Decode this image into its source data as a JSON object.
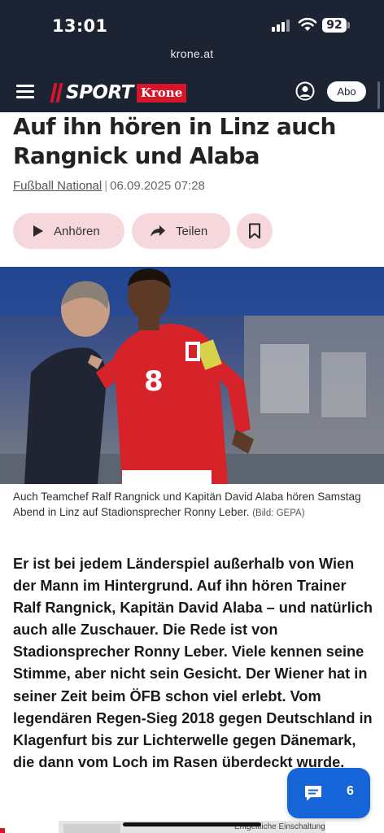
{
  "status_bar": {
    "time": "13:01",
    "battery": "92"
  },
  "browser": {
    "url": "krone.at"
  },
  "header": {
    "logo_text": "SPORT",
    "logo_brand": "Krone",
    "abo_label": "Abo"
  },
  "article": {
    "headline": "Auf ihn hören in Linz auch Rangnick und Alaba",
    "category": "Fußball National",
    "separator": "|",
    "date": "06.09.2025 07:28",
    "actions": {
      "listen_label": "Anhören",
      "share_label": "Teilen"
    },
    "caption": "Auch Teamchef Ralf Rangnick und Kapitän David Alaba hören Samstag Abend in Linz auf Stadionsprecher Ronny Leber.",
    "caption_credit": "(Bild: GEPA)",
    "lead": "Er ist bei jedem Länderspiel außerhalb von Wien der Mann im Hintergrund. Auf ihn hören Trainer Ralf Rangnick, Kapitän David Alaba – und natürlich auch alle Zuschauer. Die Rede ist von Stadionsprecher Ronny Leber. Viele kennen seine Stimme, aber nicht sein Gesicht. Der Wiener hat in seiner Zeit beim ÖFB schon viel erlebt. Vom legendären Regen-Sieg 2018 gegen Deutschland in Klagenfurt bis zur Lichterwelle gegen Dänemark, die dann vom Loch im Rasen überdeckt wurde."
  },
  "photo_jersey_number": "8",
  "comments": {
    "count": "6"
  },
  "ad": {
    "label": "Entgeltliche Einschaltung"
  },
  "colors": {
    "header_bg": "#1c2333",
    "brand_red": "#d7152a",
    "action_pill_bg": "#f6d8dc",
    "comments_blue": "#1565d8"
  },
  "icons": [
    "menu-icon",
    "user-account-icon",
    "play-icon",
    "share-arrow-icon",
    "bookmark-icon",
    "comment-icon",
    "signal-icon",
    "wifi-icon",
    "battery-icon"
  ]
}
